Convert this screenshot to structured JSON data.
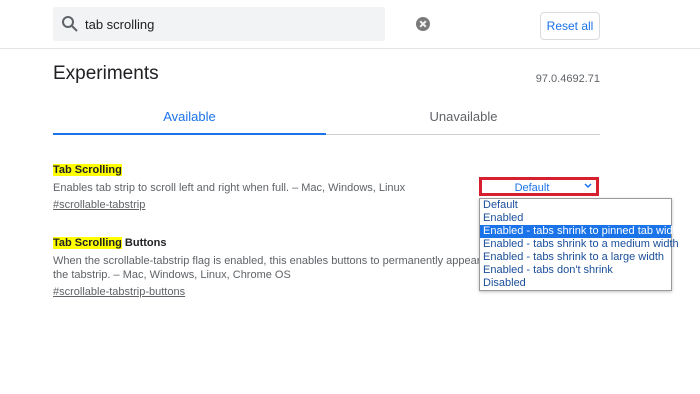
{
  "search": {
    "value": "tab scrolling",
    "icon": "search-icon",
    "clear_icon": "clear-icon"
  },
  "header": {
    "reset_label": "Reset all",
    "title": "Experiments",
    "version": "97.0.4692.71"
  },
  "tabs": [
    {
      "label": "Available",
      "active": true
    },
    {
      "label": "Unavailable",
      "active": false
    }
  ],
  "experiments": [
    {
      "name_highlight": "Tab Scrolling",
      "name_rest": "",
      "description": "Enables tab strip to scroll left and right when full. – Mac, Windows, Linux",
      "link": "#scrollable-tabstrip",
      "select_value": "Default"
    },
    {
      "name_highlight": "Tab Scrolling",
      "name_rest": " Buttons",
      "description_line1": "When the scrollable-tabstrip flag is enabled, this enables buttons to permanently appear on",
      "description_line2": "the tabstrip. – Mac, Windows, Linux, Chrome OS",
      "link": "#scrollable-tabstrip-buttons"
    }
  ],
  "dropdown": {
    "options": [
      "Default",
      "Enabled",
      "Enabled - tabs shrink to pinned tab width",
      "Enabled - tabs shrink to a medium width",
      "Enabled - tabs shrink to a large width",
      "Enabled - tabs don't shrink",
      "Disabled"
    ],
    "highlighted_index": 2
  },
  "colors": {
    "accent": "#1a73e8",
    "highlight": "#ffff00",
    "annotation_border": "#d6202f"
  }
}
